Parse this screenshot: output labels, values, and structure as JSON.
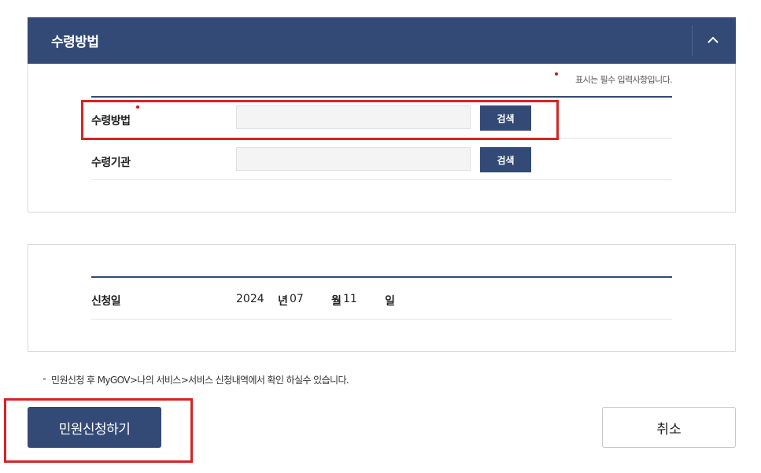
{
  "section": {
    "title": "수령방법",
    "collapse_icon": "chevron-up-icon"
  },
  "form": {
    "required_note": "표시는 필수 입력사항입니다.",
    "rows": [
      {
        "label": "수령방법",
        "required": true,
        "value": "",
        "button": "검색"
      },
      {
        "label": "수령기관",
        "required": false,
        "value": "",
        "button": "검색"
      }
    ]
  },
  "date": {
    "label": "신청일",
    "year": "2024",
    "year_unit": "년",
    "month": "07",
    "month_unit": "월",
    "day": "11",
    "day_unit": "일"
  },
  "notice": "민원신청 후 MyGOV>나의 서비스>서비스 신청내역에서 확인 하실수 있습니다.",
  "actions": {
    "submit": "민원신청하기",
    "cancel": "취소"
  },
  "colors": {
    "primary": "#344a76",
    "required_dot": "#cc1a1a",
    "highlight": "#d52424"
  }
}
